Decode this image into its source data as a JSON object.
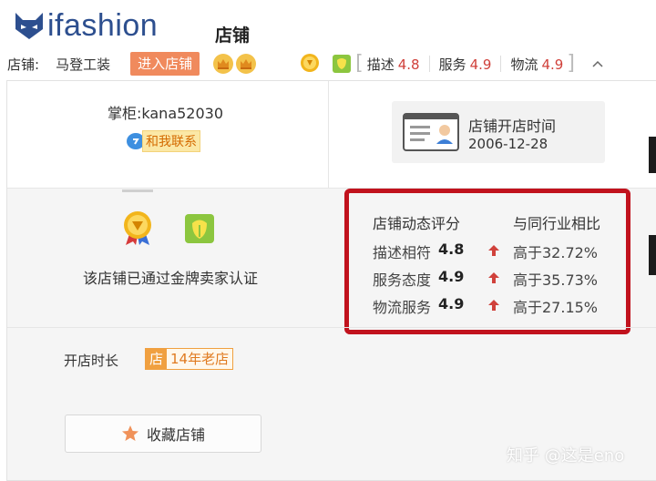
{
  "header": {
    "logo_text": "ifashion",
    "site_title": "店铺"
  },
  "shopbar": {
    "shop_label": "店铺:",
    "shop_name": "马登工装",
    "enter_button": "进入店铺",
    "scores": [
      {
        "label": "描述",
        "value": "4.8"
      },
      {
        "label": "服务",
        "value": "4.9"
      },
      {
        "label": "物流",
        "value": "4.9"
      }
    ],
    "bracket_open": "[",
    "bracket_close": "]",
    "collapse_glyph": "^"
  },
  "panel": {
    "keeper": "掌柜:kana52030",
    "contact_label": "和我联系",
    "open_time_label": "店铺开店时间",
    "open_time_value": "2006-12-28",
    "certification_text": "该店铺已通过金牌卖家认证",
    "rating": {
      "header_left": "店铺动态评分",
      "header_right": "与同行业相比",
      "rows": [
        {
          "label": "描述相符",
          "value": "4.8",
          "compare": "高于32.72%"
        },
        {
          "label": "服务态度",
          "value": "4.9",
          "compare": "高于35.73%"
        },
        {
          "label": "物流服务",
          "value": "4.9",
          "compare": "高于27.15%"
        }
      ]
    },
    "tenure_label": "开店时长",
    "tenure_badge_icon": "店",
    "tenure_badge_text": "14年老店",
    "favorite_button": "收藏店铺"
  },
  "watermark": "知乎 @这是eno",
  "colors": {
    "brand_blue": "#2d4f8f",
    "enter_button": "#f08a5d",
    "score_red": "#d0413b",
    "highlight_border": "#c1121d",
    "tenure_orange": "#f0a040"
  }
}
